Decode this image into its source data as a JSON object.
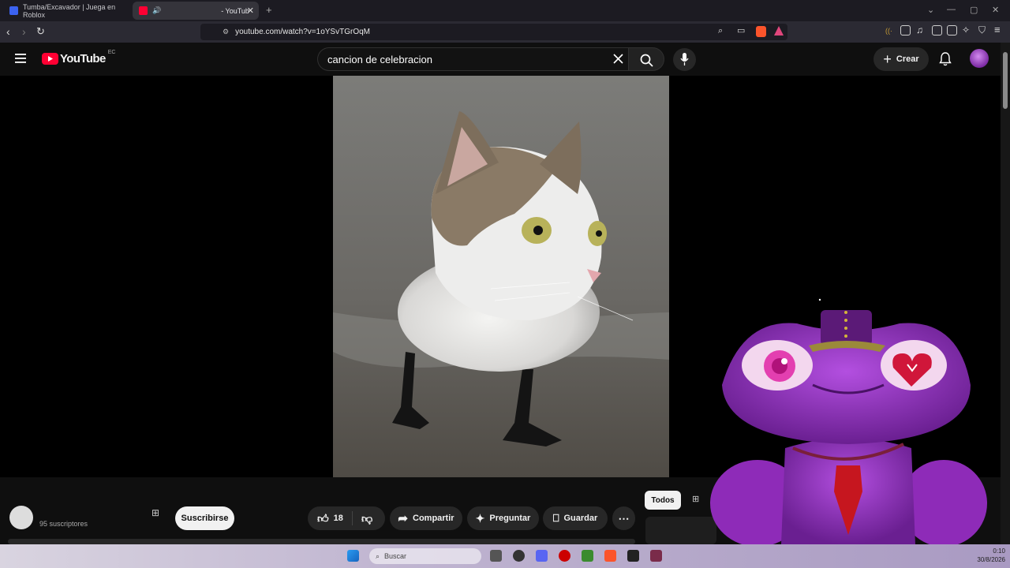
{
  "browser": {
    "tabs": [
      {
        "title": "Tumba/Excavador | Juega en Roblox",
        "active": false
      },
      {
        "title": "- YouTub",
        "active": true
      }
    ],
    "url": "youtube.com/watch?v=1oYSvTGrOqM"
  },
  "youtube": {
    "logo_text": "YouTube",
    "country_code": "EC",
    "search_query": "cancion de celebracion",
    "create_label": "Crear"
  },
  "channel": {
    "subscribers": "95 suscriptores",
    "subscribe_label": "Suscribirse"
  },
  "actions": {
    "like_count": "18",
    "share_label": "Compartir",
    "ask_label": "Preguntar",
    "save_label": "Guardar"
  },
  "filter": {
    "all_label": "Todos"
  },
  "taskbar": {
    "search_placeholder": "Buscar",
    "time": "0:10",
    "date": "30/8/2026"
  },
  "colors": {
    "youtube_red": "#ff0033",
    "frog_purple": "#8e2bb8"
  }
}
